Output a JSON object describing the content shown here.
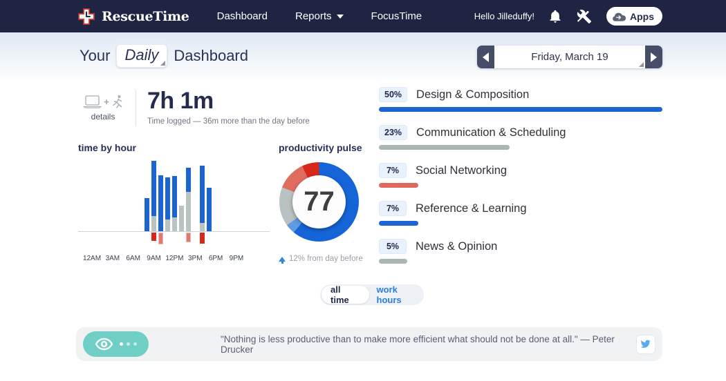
{
  "navbar": {
    "brand": "RescueTime",
    "links": [
      {
        "label": "Dashboard",
        "dropdown": false
      },
      {
        "label": "Reports",
        "dropdown": true
      },
      {
        "label": "FocusTime",
        "dropdown": false
      }
    ],
    "greeting": "Hello Jilleduffy!",
    "apps_button": "Apps"
  },
  "header": {
    "title_prefix": "Your",
    "period_selector": "Daily",
    "title_suffix": "Dashboard",
    "date_label": "Friday, March 19"
  },
  "summary": {
    "details_label": "details",
    "time_logged": "7h 1m",
    "time_note": "Time logged — 36m more than the day before"
  },
  "toggle": {
    "options": [
      {
        "label": "all time",
        "active": true
      },
      {
        "label": "work hours",
        "active": false
      }
    ]
  },
  "quote": {
    "text": "\"Nothing is less productive than to make more efficient what should not be done at all.\" — Peter Drucker"
  },
  "colors": {
    "navbar_bg": "#1e2442",
    "accent_blue": "#1b64d2",
    "neutral_gray": "#b9c3c2",
    "distracting_red": "#e0796f",
    "very_distracting_red": "#d6291c",
    "teal": "#6fcfc5",
    "link_blue": "#2b7fd8",
    "twitter_blue": "#55acee"
  },
  "chart_data": [
    {
      "type": "bar",
      "title": "time by hour",
      "stacked": true,
      "x_axis_ticks": [
        "12AM",
        "3AM",
        "6AM",
        "9AM",
        "12PM",
        "3PM",
        "6PM",
        "9PM"
      ],
      "hours": [
        "8AM",
        "9AM",
        "10AM",
        "11AM",
        "12PM",
        "1PM",
        "2PM",
        "4PM",
        "5PM"
      ],
      "series": [
        {
          "name": "productive",
          "color": "#1b64d2",
          "below_axis": false,
          "values": [
            48,
            80,
            81,
            61,
            60,
            0,
            35,
            83,
            63
          ]
        },
        {
          "name": "neutral",
          "color": "#b9c3c2",
          "below_axis": false,
          "values": [
            0,
            22,
            0,
            17,
            20,
            37,
            57,
            12,
            0
          ]
        },
        {
          "name": "distracting",
          "color": "#e0796f",
          "below_axis": true,
          "values": [
            0,
            0,
            17,
            0,
            0,
            0,
            14,
            0,
            0
          ]
        },
        {
          "name": "very-distracting",
          "color": "#d6291c",
          "below_axis": true,
          "values": [
            0,
            12,
            0,
            0,
            0,
            0,
            0,
            16,
            0
          ]
        }
      ],
      "units": "relative height (no value axis shown in UI)"
    },
    {
      "type": "pie",
      "title": "productivity pulse",
      "center_value": "77",
      "change": "12% from day before",
      "segments": [
        {
          "name": "very productive",
          "value": 61,
          "color": "#1565d8"
        },
        {
          "name": "productive",
          "value": 4,
          "color": "#5f9ce4"
        },
        {
          "name": "neutral",
          "value": 16,
          "color": "#b9c2c2"
        },
        {
          "name": "distracting",
          "value": 12,
          "color": "#e06c60"
        },
        {
          "name": "very distracting",
          "value": 7,
          "color": "#d6291c"
        }
      ]
    },
    {
      "type": "bar",
      "title": "top categories",
      "categories": [
        "Design & Composition",
        "Communication & Scheduling",
        "Social Networking",
        "Reference & Learning",
        "News & Opinion"
      ],
      "values": [
        50,
        23,
        7,
        7,
        5
      ],
      "value_labels": [
        "50%",
        "23%",
        "7%",
        "7%",
        "5%"
      ],
      "colors": [
        "#1b64d2",
        "#a9b6b3",
        "#e0695e",
        "#1b64d2",
        "#a9b6b3"
      ]
    }
  ]
}
